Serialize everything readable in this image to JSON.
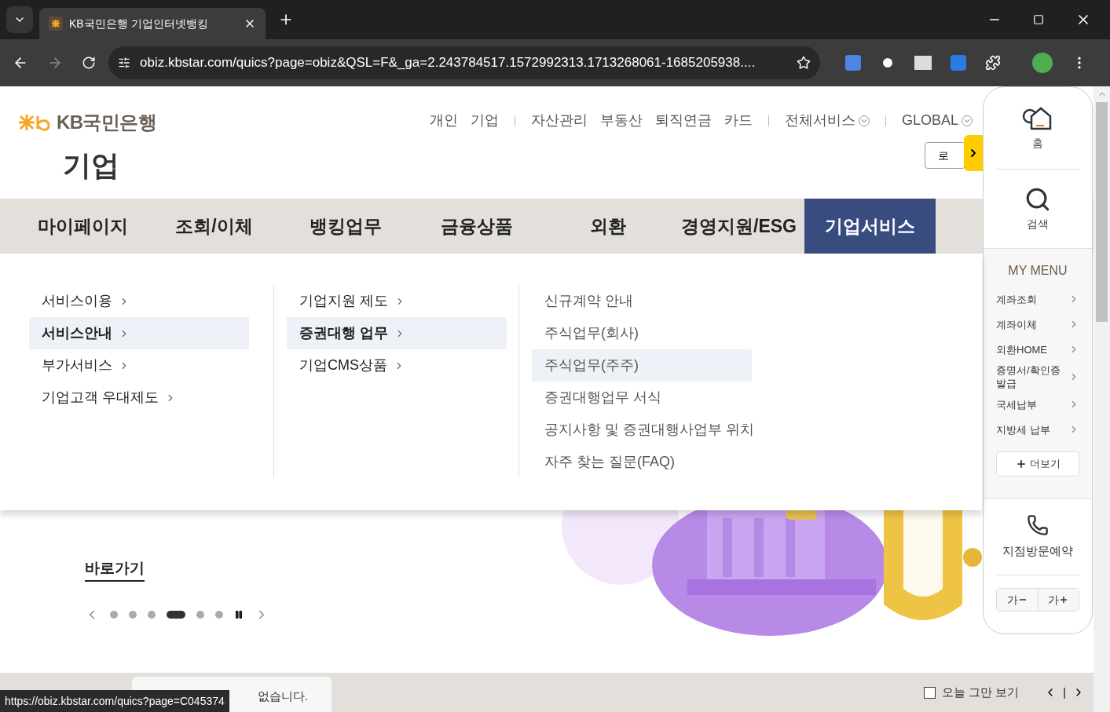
{
  "browser": {
    "tab_title": "KB국민은행 기업인터넷뱅킹",
    "url": "obiz.kbstar.com/quics?page=obiz&QSL=F&_ga=2.243784517.1572992313.1713268061-1685205938...."
  },
  "header": {
    "logo_text": "KB국민은행",
    "section_title": "기업",
    "login_button": "로",
    "top_links": [
      {
        "label": "개인",
        "kind": "link"
      },
      {
        "label": "기업",
        "kind": "link"
      },
      {
        "label": "자산관리",
        "kind": "link"
      },
      {
        "label": "부동산",
        "kind": "link"
      },
      {
        "label": "퇴직연금",
        "kind": "link"
      },
      {
        "label": "카드",
        "kind": "link"
      },
      {
        "label": "전체서비스",
        "kind": "dropdown"
      },
      {
        "label": "GLOBAL",
        "kind": "dropdown"
      }
    ]
  },
  "nav": [
    {
      "label": "마이페이지",
      "selected": false
    },
    {
      "label": "조회/이체",
      "selected": false
    },
    {
      "label": "뱅킹업무",
      "selected": false
    },
    {
      "label": "금융상품",
      "selected": false
    },
    {
      "label": "외환",
      "selected": false
    },
    {
      "label": "경영지원/ESG",
      "selected": false
    },
    {
      "label": "기업서비스",
      "selected": true
    }
  ],
  "dropdown": {
    "columns": [
      [
        {
          "label": "서비스이용",
          "selected": false,
          "arrow": true
        },
        {
          "label": "서비스안내",
          "selected": true,
          "arrow": true
        },
        {
          "label": "부가서비스",
          "selected": false,
          "arrow": true
        },
        {
          "label": "기업고객 우대제도",
          "selected": false,
          "arrow": true
        }
      ],
      [
        {
          "label": "기업지원 제도",
          "selected": false,
          "arrow": true
        },
        {
          "label": "증권대행 업무",
          "selected": true,
          "arrow": true
        },
        {
          "label": "기업CMS상품",
          "selected": false,
          "arrow": true
        }
      ],
      [
        {
          "label": "신규계약 안내",
          "selected": false,
          "arrow": false
        },
        {
          "label": "주식업무(회사)",
          "selected": false,
          "arrow": false
        },
        {
          "label": "주식업무(주주)",
          "selected": true,
          "arrow": false
        },
        {
          "label": "증권대행업무 서식",
          "selected": false,
          "arrow": false
        },
        {
          "label": "공지사항 및 증권대행사업부 위치",
          "selected": false,
          "arrow": false
        },
        {
          "label": "자주 찾는 질문(FAQ)",
          "selected": false,
          "arrow": false
        }
      ]
    ]
  },
  "hero": {
    "link": "바로가기",
    "dots": [
      {
        "selected": false
      },
      {
        "selected": false
      },
      {
        "selected": false
      },
      {
        "selected": true
      },
      {
        "selected": false
      },
      {
        "selected": false
      }
    ]
  },
  "bottom_bar": {
    "recent_note": "없습니다.",
    "today_checkbox": {
      "label": "오늘 그만 보기",
      "checked": false
    },
    "separator": "|"
  },
  "quick_panel": {
    "home": "홈",
    "search": "검색",
    "my_menu_title": "MY MENU",
    "my_menu": [
      "계좌조회",
      "계좌이체",
      "외환HOME",
      "증명서/확인증 발급",
      "국세납부",
      "지방세 납부"
    ],
    "more": "더보기",
    "visit": "지점방문예약",
    "font_down": "가",
    "font_up": "가"
  },
  "status_url": "https://obiz.kbstar.com/quics?page=C045374"
}
